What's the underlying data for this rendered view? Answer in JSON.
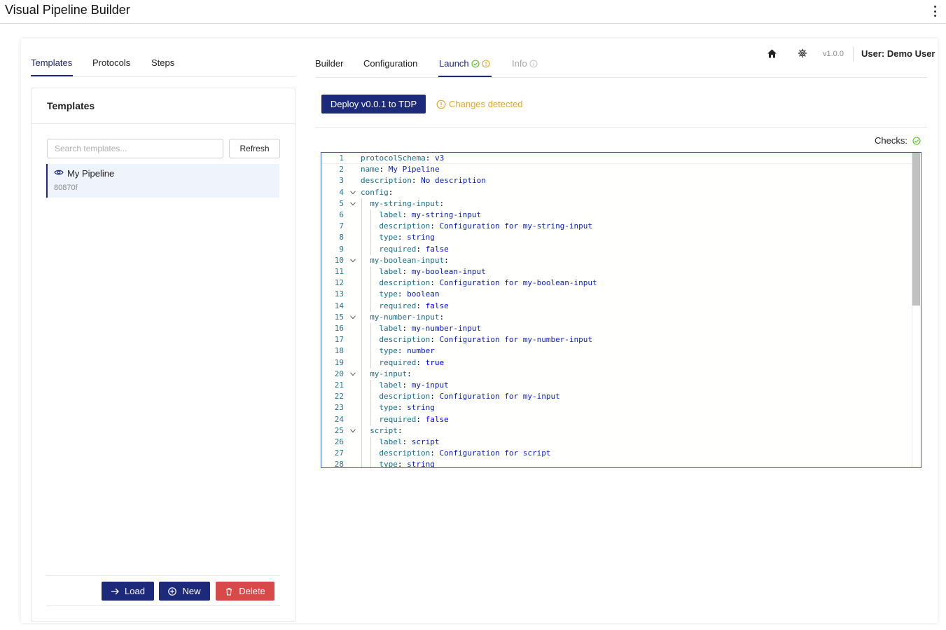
{
  "app": {
    "title": "Visual Pipeline Builder"
  },
  "left": {
    "tabs": [
      "Templates",
      "Protocols",
      "Steps"
    ],
    "panel_title": "Templates",
    "search_placeholder": "Search templates...",
    "refresh_label": "Refresh",
    "items": [
      {
        "name": "My Pipeline",
        "id": "80870f"
      }
    ],
    "buttons": {
      "load": "Load",
      "new": "New",
      "delete": "Delete"
    }
  },
  "right": {
    "tabs": [
      "Builder",
      "Configuration",
      "Launch",
      "Info"
    ],
    "version": "v1.0.0",
    "user": "User: Demo User",
    "deploy_label": "Deploy v0.0.1 to TDP",
    "changes_label": "Changes detected",
    "checks_label": "Checks:"
  },
  "colors": {
    "primary": "#1d2a7a",
    "danger": "#d84a4a",
    "warning": "#e0a82e",
    "success": "#52c41a"
  },
  "editor": {
    "lines": [
      {
        "n": 1,
        "indent": 0,
        "key": "protocolSchema",
        "val": "v3",
        "kind": "str",
        "fold": false
      },
      {
        "n": 2,
        "indent": 0,
        "key": "name",
        "val": "My Pipeline",
        "kind": "str",
        "fold": false
      },
      {
        "n": 3,
        "indent": 0,
        "key": "description",
        "val": "No description",
        "kind": "str",
        "fold": false
      },
      {
        "n": 4,
        "indent": 0,
        "key": "config",
        "val": "",
        "kind": "str",
        "fold": true
      },
      {
        "n": 5,
        "indent": 1,
        "key": "my-string-input",
        "val": "",
        "kind": "str",
        "fold": true
      },
      {
        "n": 6,
        "indent": 2,
        "key": "label",
        "val": "my-string-input",
        "kind": "str",
        "fold": false
      },
      {
        "n": 7,
        "indent": 2,
        "key": "description",
        "val": "Configuration for my-string-input",
        "kind": "str",
        "fold": false
      },
      {
        "n": 8,
        "indent": 2,
        "key": "type",
        "val": "string",
        "kind": "str",
        "fold": false
      },
      {
        "n": 9,
        "indent": 2,
        "key": "required",
        "val": "false",
        "kind": "bool",
        "fold": false
      },
      {
        "n": 10,
        "indent": 1,
        "key": "my-boolean-input",
        "val": "",
        "kind": "str",
        "fold": true
      },
      {
        "n": 11,
        "indent": 2,
        "key": "label",
        "val": "my-boolean-input",
        "kind": "str",
        "fold": false
      },
      {
        "n": 12,
        "indent": 2,
        "key": "description",
        "val": "Configuration for my-boolean-input",
        "kind": "str",
        "fold": false
      },
      {
        "n": 13,
        "indent": 2,
        "key": "type",
        "val": "boolean",
        "kind": "str",
        "fold": false
      },
      {
        "n": 14,
        "indent": 2,
        "key": "required",
        "val": "false",
        "kind": "bool",
        "fold": false
      },
      {
        "n": 15,
        "indent": 1,
        "key": "my-number-input",
        "val": "",
        "kind": "str",
        "fold": true
      },
      {
        "n": 16,
        "indent": 2,
        "key": "label",
        "val": "my-number-input",
        "kind": "str",
        "fold": false
      },
      {
        "n": 17,
        "indent": 2,
        "key": "description",
        "val": "Configuration for my-number-input",
        "kind": "str",
        "fold": false
      },
      {
        "n": 18,
        "indent": 2,
        "key": "type",
        "val": "number",
        "kind": "str",
        "fold": false
      },
      {
        "n": 19,
        "indent": 2,
        "key": "required",
        "val": "true",
        "kind": "bool",
        "fold": false
      },
      {
        "n": 20,
        "indent": 1,
        "key": "my-input",
        "val": "",
        "kind": "str",
        "fold": true
      },
      {
        "n": 21,
        "indent": 2,
        "key": "label",
        "val": "my-input",
        "kind": "str",
        "fold": false
      },
      {
        "n": 22,
        "indent": 2,
        "key": "description",
        "val": "Configuration for my-input",
        "kind": "str",
        "fold": false
      },
      {
        "n": 23,
        "indent": 2,
        "key": "type",
        "val": "string",
        "kind": "str",
        "fold": false
      },
      {
        "n": 24,
        "indent": 2,
        "key": "required",
        "val": "false",
        "kind": "bool",
        "fold": false
      },
      {
        "n": 25,
        "indent": 1,
        "key": "script",
        "val": "",
        "kind": "str",
        "fold": true
      },
      {
        "n": 26,
        "indent": 2,
        "key": "label",
        "val": "script",
        "kind": "str",
        "fold": false
      },
      {
        "n": 27,
        "indent": 2,
        "key": "description",
        "val": "Configuration for script",
        "kind": "str",
        "fold": false
      },
      {
        "n": 28,
        "indent": 2,
        "key": "type",
        "val": "string",
        "kind": "str",
        "fold": false
      }
    ]
  }
}
